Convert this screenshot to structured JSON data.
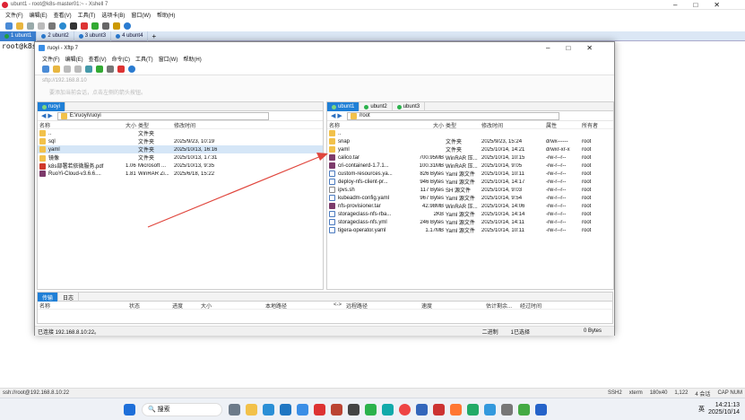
{
  "xshell": {
    "title": "ubunt1 - root@k8s-master01:~ - Xshell 7",
    "menu": [
      "文件(F)",
      "编辑(E)",
      "查看(V)",
      "工具(T)",
      "选项卡(B)",
      "窗口(W)",
      "帮助(H)"
    ],
    "tabs": [
      {
        "label": "1 ubunt1",
        "active": true,
        "color": "#1e9e3e"
      },
      {
        "label": "2 ubunt2",
        "color": "#2a7bd0"
      },
      {
        "label": "3 ubunt3",
        "color": "#2a7bd0"
      },
      {
        "label": "4 ubunt4",
        "color": "#2a7bd0"
      }
    ],
    "tab_add": "+",
    "terminal_text": "root@k8s-",
    "status": {
      "conn": "ssh://root@192.168.8.10:22",
      "ssh": "SSH2",
      "term": "xterm",
      "size": "180x40",
      "pos": "1,122",
      "sessions": "4 会话",
      "caps": "CAP NUM"
    }
  },
  "xftp": {
    "title": "ruoyi - Xftp 7",
    "menu": [
      "文件(F)",
      "编辑(E)",
      "查看(V)",
      "命令(C)",
      "工具(T)",
      "窗口(W)",
      "帮助(H)"
    ],
    "address": "sftp://192.168.8.10",
    "hint": "要添加当前会话，点击左侧的箭头按钮。",
    "left": {
      "tabs": [
        "ruoyi"
      ],
      "path": "E:\\ruoyi\\ruoyi",
      "headers": [
        "名称",
        "大小",
        "类型",
        "修改时间"
      ],
      "rows": [
        {
          "name": "..",
          "size": "",
          "type": "文件夹",
          "date": "",
          "icon": "folder"
        },
        {
          "name": "sql",
          "size": "",
          "type": "文件夹",
          "date": "2025/9/23, 10:19",
          "icon": "folder"
        },
        {
          "name": "yaml",
          "size": "",
          "type": "文件夹",
          "date": "2025/10/13, 16:16",
          "icon": "folder",
          "selected": true
        },
        {
          "name": "镜像",
          "size": "",
          "type": "文件夹",
          "date": "2025/10/13, 17:31",
          "icon": "folder"
        },
        {
          "name": "k8s部署若依微服务.pdf",
          "size": "1.06MB",
          "type": "Microsoft ...",
          "date": "2025/10/13, 9:35",
          "icon": "pdf"
        },
        {
          "name": "RuoYi-Cloud-v3.6.6....",
          "size": "1.81MB",
          "type": "WinRAR Zi...",
          "date": "2025/6/18, 15:22",
          "icon": "rar"
        }
      ]
    },
    "right": {
      "tabs": [
        "ubunt1",
        "ubunt2",
        "ubunt3"
      ],
      "path": "/root",
      "headers": [
        "名称",
        "大小",
        "类型",
        "修改时间",
        "属性",
        "所有者"
      ],
      "rows": [
        {
          "name": "..",
          "size": "",
          "type": "",
          "date": "",
          "attr": "",
          "owner": "",
          "icon": "folder"
        },
        {
          "name": "snap",
          "size": "",
          "type": "文件夹",
          "date": "2025/9/23, 15:24",
          "attr": "drwx------",
          "owner": "root",
          "icon": "folder"
        },
        {
          "name": "yaml",
          "size": "",
          "type": "文件夹",
          "date": "2025/10/14, 14:21",
          "attr": "drwxr-xr-x",
          "owner": "root",
          "icon": "folder"
        },
        {
          "name": "calico.tar",
          "size": "700.95MB",
          "type": "WinRAR 压...",
          "date": "2025/10/14, 10:15",
          "attr": "-rw-r--r--",
          "owner": "root",
          "icon": "rar"
        },
        {
          "name": "cri-containerd-1.7.1...",
          "size": "100.31MB",
          "type": "WinRAR 压...",
          "date": "2025/10/14, 9:05",
          "attr": "-rw-r--r--",
          "owner": "root",
          "icon": "rar"
        },
        {
          "name": "custom-resources.ya...",
          "size": "826 Bytes",
          "type": "Yaml 源文件",
          "date": "2025/10/14, 10:11",
          "attr": "-rw-r--r--",
          "owner": "root",
          "icon": "yaml"
        },
        {
          "name": "deploy-nfs-client-pr...",
          "size": "946 Bytes",
          "type": "Yaml 源文件",
          "date": "2025/10/14, 14:17",
          "attr": "-rw-r--r--",
          "owner": "root",
          "icon": "yaml"
        },
        {
          "name": "ipvs.sh",
          "size": "117 Bytes",
          "type": "SH 源文件",
          "date": "2025/10/14, 9:03",
          "attr": "-rw-r--r--",
          "owner": "root",
          "icon": "file"
        },
        {
          "name": "kubeadm-config.yaml",
          "size": "967 Bytes",
          "type": "Yaml 源文件",
          "date": "2025/10/14, 9:54",
          "attr": "-rw-r--r--",
          "owner": "root",
          "icon": "yaml"
        },
        {
          "name": "nfs-provisioner.tar",
          "size": "42.98MB",
          "type": "WinRAR 压...",
          "date": "2025/10/14, 14:06",
          "attr": "-rw-r--r--",
          "owner": "root",
          "icon": "rar"
        },
        {
          "name": "storageclass-nfs-rba...",
          "size": "2KB",
          "type": "Yaml 源文件",
          "date": "2025/10/14, 14:14",
          "attr": "-rw-r--r--",
          "owner": "root",
          "icon": "yaml"
        },
        {
          "name": "storageclass-nfs.yml",
          "size": "246 Bytes",
          "type": "Yaml 源文件",
          "date": "2025/10/14, 14:11",
          "attr": "-rw-r--r--",
          "owner": "root",
          "icon": "yaml"
        },
        {
          "name": "tigera-operator.yaml",
          "size": "1.17MB",
          "type": "Yaml 源文件",
          "date": "2025/10/14, 10:11",
          "attr": "-rw-r--r--",
          "owner": "root",
          "icon": "yaml"
        }
      ]
    },
    "transfer": {
      "tabs": [
        "传输",
        "日志"
      ],
      "headers": [
        "名称",
        "状态",
        "进度",
        "大小",
        "本地路径",
        "<->",
        "远程路径",
        "速度",
        "估计剩余...",
        "经过时间"
      ]
    },
    "status": {
      "left": "已连接 192.168.8.10:22。",
      "mode": "二进制",
      "count": "1已选择",
      "size": "0 Bytes"
    }
  },
  "taskbar": {
    "search": "搜索",
    "tray": {
      "lang": "英",
      "time": "14:21:13",
      "date": "2025/10/14"
    }
  },
  "colors": {
    "accent": "#1f7fd6",
    "annotation_arrow": "#e0463d"
  }
}
